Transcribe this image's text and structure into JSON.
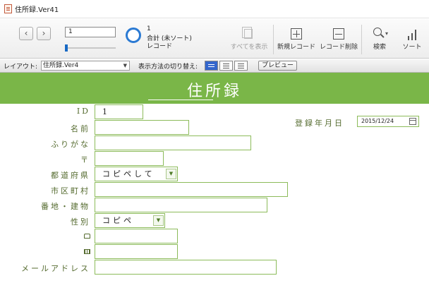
{
  "window": {
    "title": "住所録.Ver41"
  },
  "toolbar": {
    "prev_icon": "chevron-left-icon",
    "next_icon": "chevron-right-icon",
    "record_number": "1",
    "record_slider_fraction": 0.0,
    "count_value": "1",
    "count_total_label": "合計 (未ソート)",
    "count_unit": "レコード",
    "show_all_label": "すべてを表示",
    "new_record_label": "新規レコード",
    "delete_record_label": "レコード削除",
    "search_label": "検索",
    "sort_label": "ソート"
  },
  "layoutbar": {
    "layout_label": "レイアウト:",
    "layout_value": "住所録.Ver4",
    "view_label": "表示方法の切り替え:",
    "preview_label": "プレビュー"
  },
  "header": {
    "title": "住所録"
  },
  "form": {
    "labels": {
      "id": "ID",
      "name": "名前",
      "furigana": "ふりがな",
      "postal": "〒",
      "prefecture": "都道府県",
      "city": "市区町村",
      "address": "番地・建物",
      "gender": "性別",
      "phone_icon": "phone-icon",
      "fax_icon": "fax-icon",
      "email": "メールアドレス",
      "registered": "登録年月日"
    },
    "values": {
      "id": "1",
      "name": "",
      "furigana": "",
      "postal": "",
      "prefecture": "コピペして",
      "city": "",
      "address": "",
      "gender": "コピペ",
      "phone": "",
      "fax": "",
      "email": "",
      "registered": "2015/12/24"
    }
  },
  "colors": {
    "header_green": "#7ab648",
    "field_border": "#8cbb5a",
    "label_text": "#556b2f",
    "accent_blue": "#2b7ad3"
  }
}
